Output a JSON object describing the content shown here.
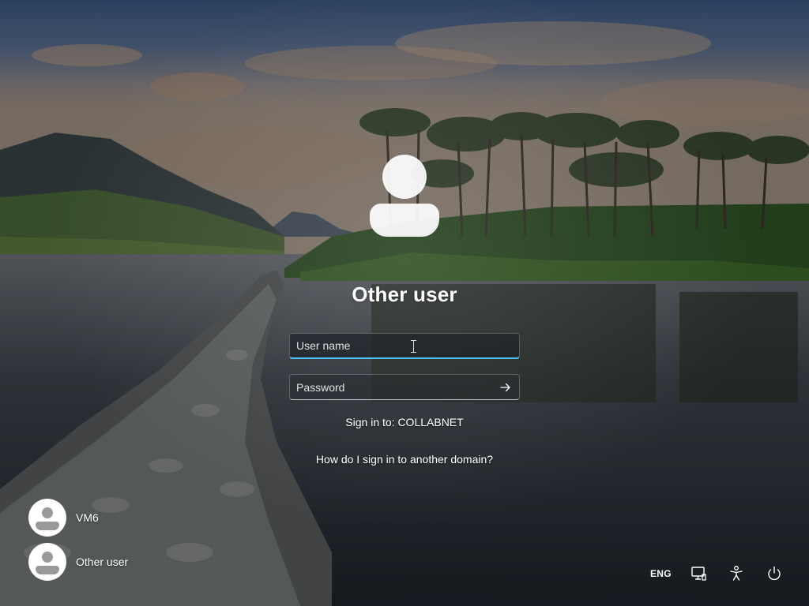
{
  "lock_screen": {
    "selected_user": "Other user",
    "username_field": {
      "placeholder": "User name",
      "value": ""
    },
    "password_field": {
      "placeholder": "Password",
      "value": ""
    },
    "sign_in_to": "Sign in to: COLLABNET",
    "domain_help_link": "How do I sign in to another domain?"
  },
  "user_list": [
    {
      "name": "VM6"
    },
    {
      "name": "Other user"
    }
  ],
  "system_tray": {
    "language": "ENG",
    "icons": [
      "network-icon",
      "accessibility-icon",
      "power-icon"
    ]
  },
  "colors": {
    "focus_accent": "#4cc2ff",
    "field_background": "#282c32",
    "text": "#ffffff"
  }
}
